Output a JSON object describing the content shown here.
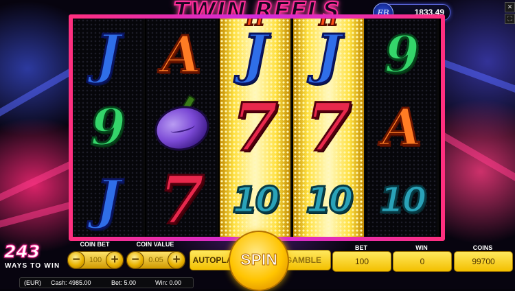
{
  "game": {
    "title": "TWIN REELS",
    "balance_icon": "FB",
    "balance": "1833.49"
  },
  "reels": [
    {
      "lit": false,
      "symbols": [
        "J",
        "9",
        "J"
      ]
    },
    {
      "lit": false,
      "symbols": [
        "A",
        "plum",
        "7"
      ]
    },
    {
      "lit": true,
      "symbols": [
        "J",
        "7",
        "10"
      ]
    },
    {
      "lit": true,
      "symbols": [
        "J",
        "7",
        "10"
      ]
    },
    {
      "lit": false,
      "symbols": [
        "9",
        "A",
        "10"
      ]
    }
  ],
  "controls": {
    "ways_number": "243",
    "ways_text": "WAYS TO WIN",
    "coin_bet_label": "COIN BET",
    "coin_bet_value": "100",
    "coin_value_label": "COIN VALUE",
    "coin_value_value": "0.05",
    "autoplay_label": "AUTOPLAY",
    "spin_label": "SPIN",
    "gamble_label": "GAMBLE",
    "bet_label": "BET",
    "bet_value": "100",
    "win_label": "WIN",
    "win_value": "0",
    "coins_label": "COINS",
    "coins_value": "99700",
    "minus": "−",
    "plus": "+"
  },
  "status_bar": {
    "currency": "(EUR)",
    "cash": "Cash: 4985.00",
    "bet": "Bet: 5.00",
    "win": "Win: 0.00"
  },
  "window_icons": {
    "close": "✕",
    "fullscreen": "⛶"
  },
  "colors": {
    "frame": "#ff2f7e",
    "button_gold": "#ffc400",
    "logo_pink": "#ff2d9a"
  }
}
